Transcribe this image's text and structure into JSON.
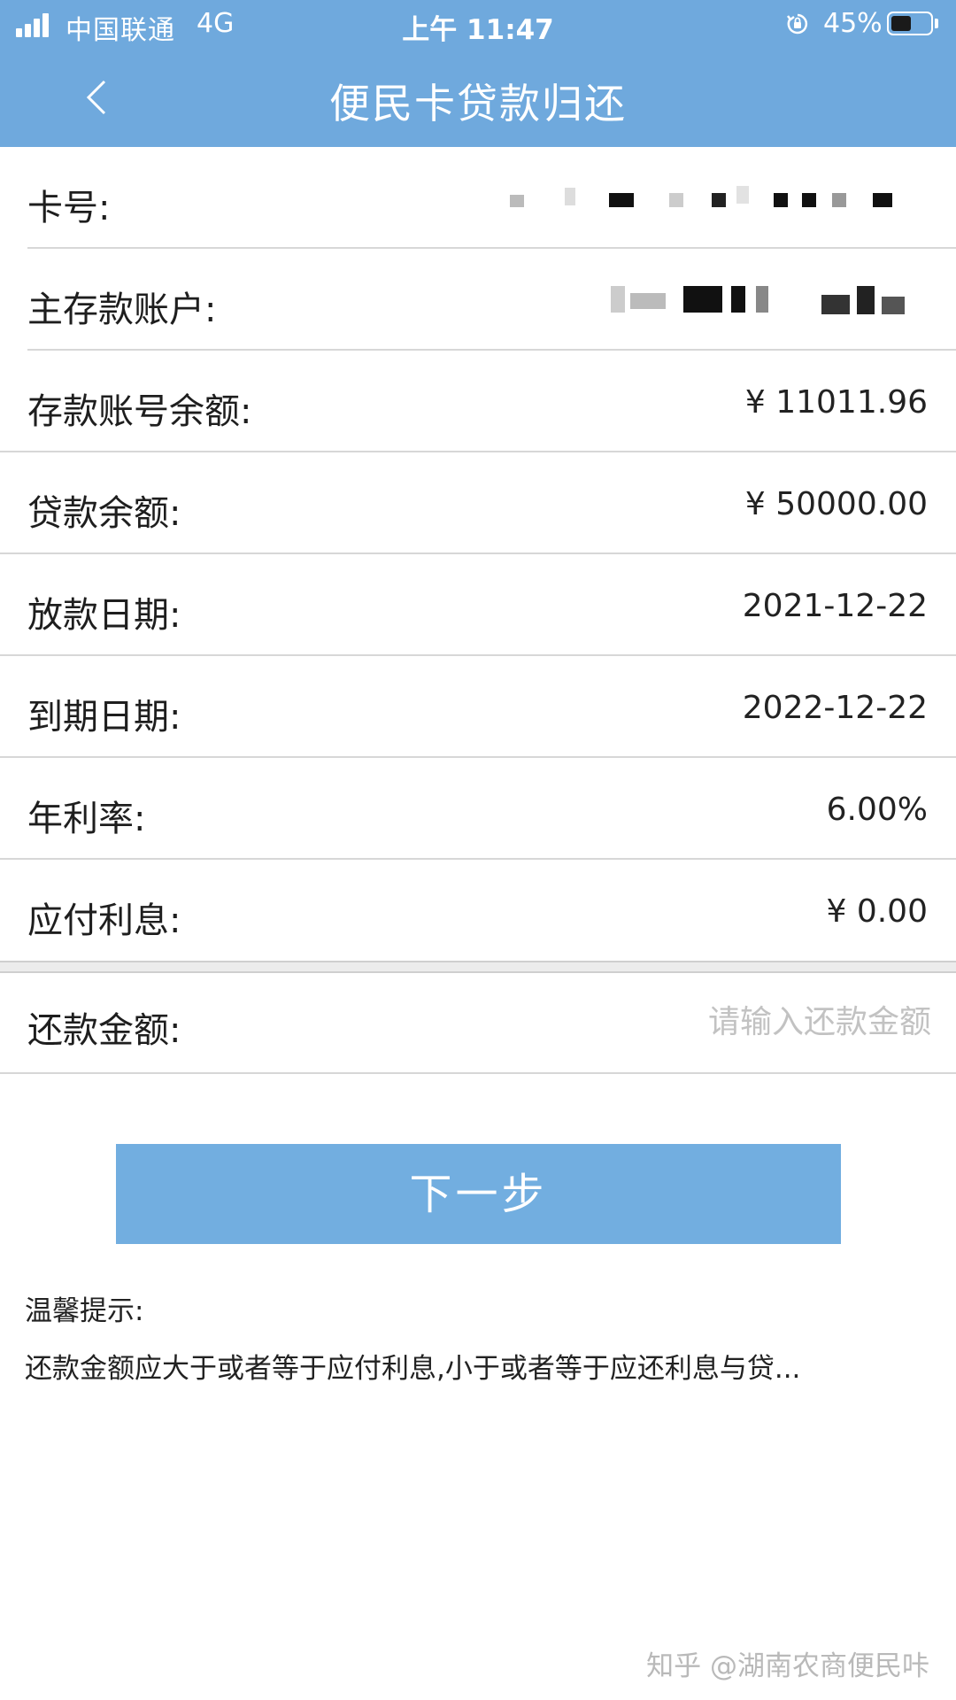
{
  "status_bar": {
    "carrier": "中国联通",
    "network": "4G",
    "time": "上午 11:47",
    "battery": "45%",
    "battery_level": 0.45,
    "signal_icon": "signal-bars-icon",
    "lock_icon": "orientation-lock-icon"
  },
  "nav": {
    "title": "便民卡贷款归还",
    "back_icon": "chevron-left-icon"
  },
  "rows": [
    {
      "label": "卡号:",
      "value": null,
      "masked": true
    },
    {
      "label": "主存款账户:",
      "value": null,
      "masked": true
    },
    {
      "label": "存款账号余额:",
      "value": "¥ 11011.96"
    },
    {
      "label": "贷款余额:",
      "value": "¥ 50000.00"
    },
    {
      "label": "放款日期:",
      "value": "2021-12-22"
    },
    {
      "label": "到期日期:",
      "value": "2022-12-22"
    },
    {
      "label": "年利率:",
      "value": "6.00%"
    },
    {
      "label": "应付利息:",
      "value": "¥ 0.00"
    }
  ],
  "repay": {
    "label": "还款金额:",
    "placeholder": "请输入还款金额",
    "value": ""
  },
  "next_button": "下一步",
  "tips": {
    "title": "温馨提示:",
    "text": "还款金额应大于或者等于应付利息,小于或者等于应还利息与贷..."
  },
  "watermark": "知乎 @湖南农商便民咔",
  "colors": {
    "header": "#6FA9DD",
    "button": "#72AEE0",
    "placeholder": "#c2c2c2"
  }
}
